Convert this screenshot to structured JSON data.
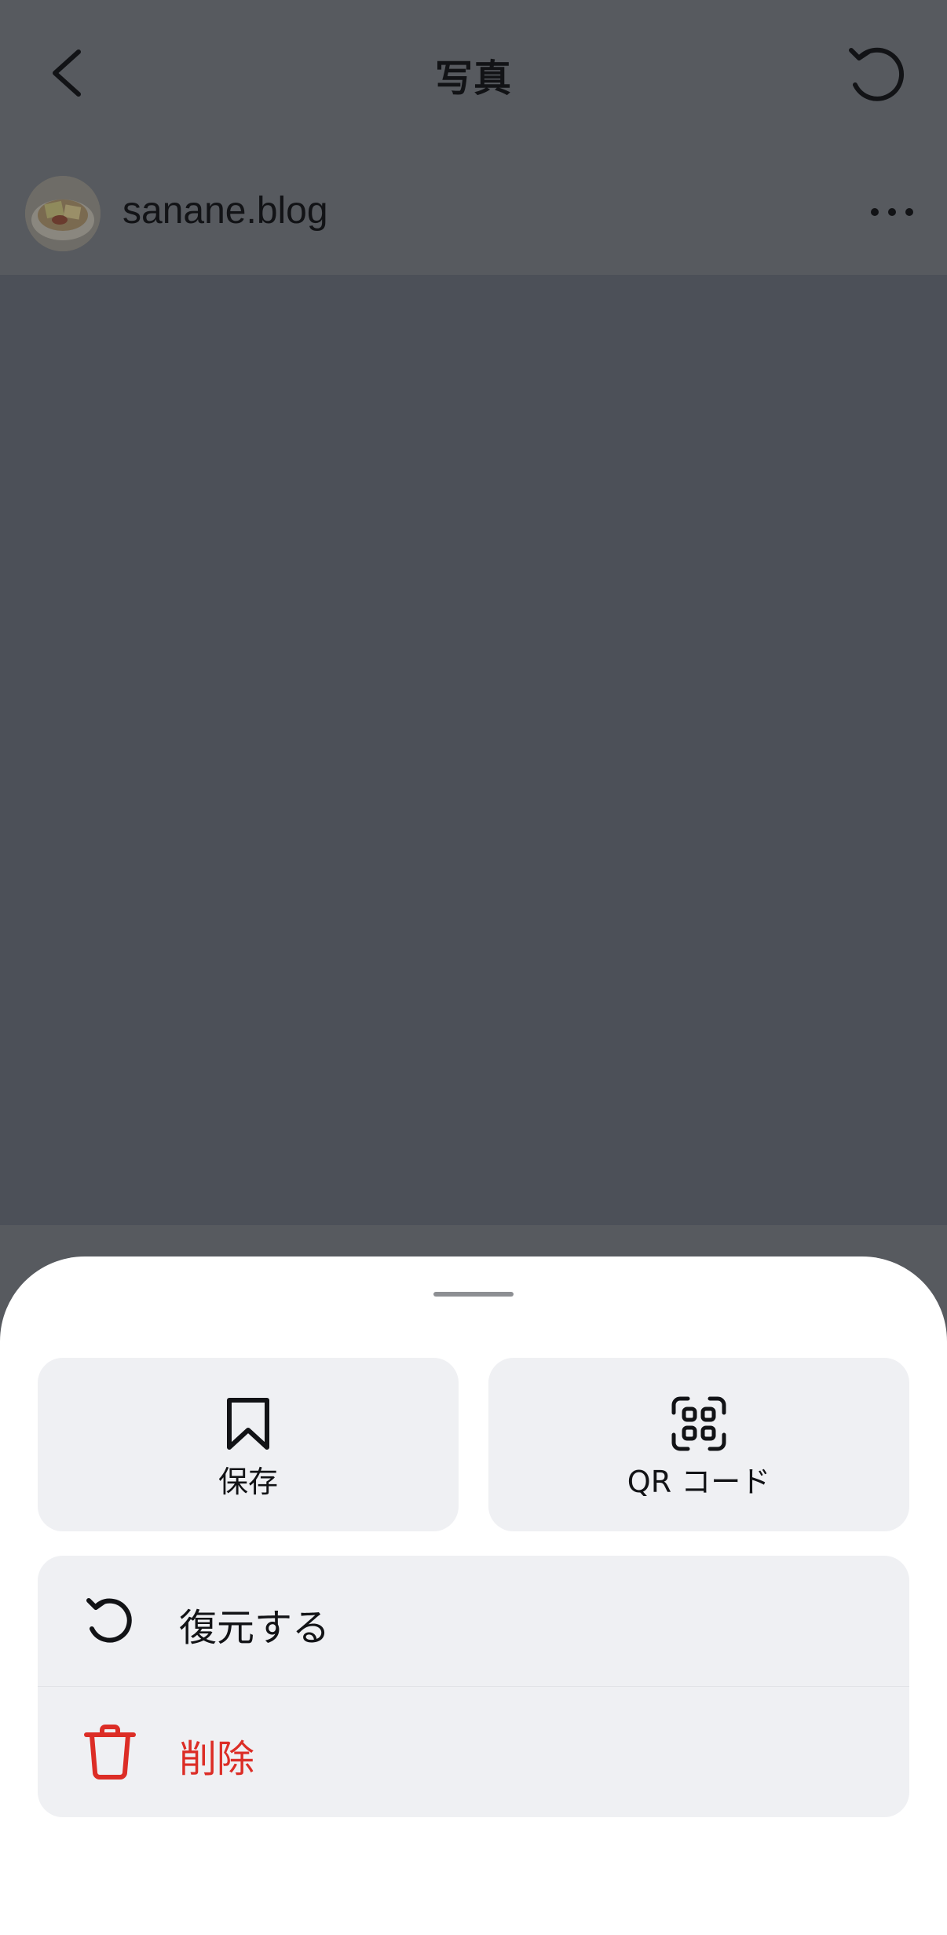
{
  "header": {
    "title": "写真",
    "back_icon": "chevron-left-icon",
    "restore_icon": "undo-icon"
  },
  "post": {
    "username": "sanane.blog",
    "more_icon": "ellipsis-icon"
  },
  "sheet": {
    "tiles": [
      {
        "label": "保存",
        "icon": "bookmark-icon"
      },
      {
        "label": "QR コード",
        "icon": "qr-scan-icon"
      }
    ],
    "actions": [
      {
        "label": "復元する",
        "icon": "undo-icon",
        "color": "#121316"
      },
      {
        "label": "削除",
        "icon": "trash-icon",
        "color": "#dc2d26"
      }
    ]
  },
  "colors": {
    "overlay_background": "#575a5f",
    "photo_background": "#4c5058",
    "sheet_background": "#ffffff",
    "tile_background": "#eff0f3",
    "destructive": "#dc2d26"
  }
}
